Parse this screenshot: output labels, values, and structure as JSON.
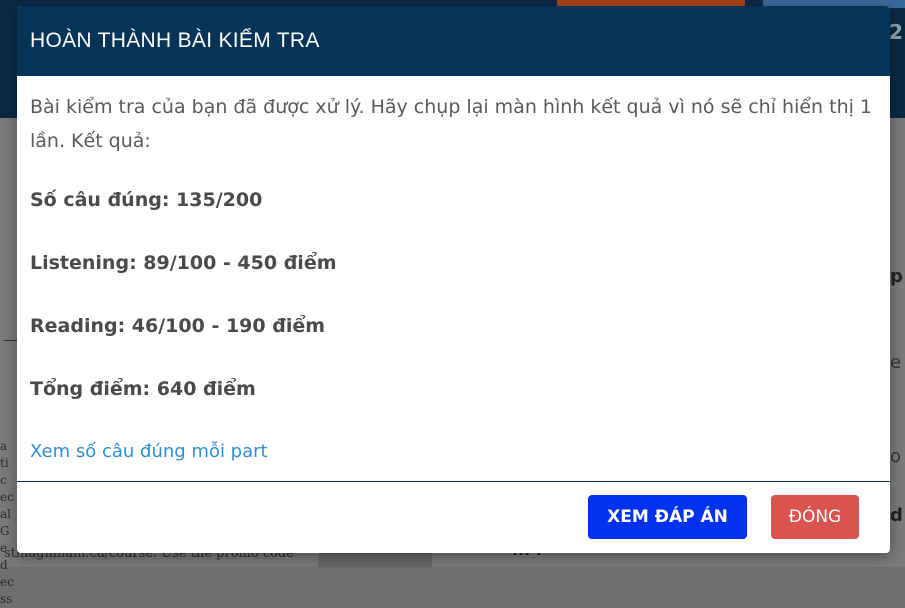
{
  "modal": {
    "title": "HOÀN THÀNH BÀI KIỂM TRA",
    "intro": "Bài kiểm tra của bạn đã được xử lý. Hãy chụp lại màn hình kết quả vì nó sẽ chỉ hiển thị 1 lần. Kết quả:",
    "results": {
      "correct": "Số câu đúng: 135/200",
      "listening": "Listening: 89/100 - 450 điểm",
      "reading": "Reading: 46/100 - 190 điểm",
      "total": "Tổng điểm: 640 điểm"
    },
    "detail_link": "Xem số câu đúng mỗi part",
    "buttons": {
      "view_answers": "XEM ĐÁP ÁN",
      "close": "ĐÓNG"
    },
    "colors": {
      "header": "#063456",
      "primary_button": "#0232ee",
      "close_button": "#d9534f",
      "link": "#2f8fd8"
    }
  },
  "background": {
    "header_digit": "2",
    "left_column_text": "stinagillham.ca/course. Use the promo code",
    "left_edge_text": "a tic ec al G ed ec ss",
    "right_letters": [
      "p",
      "e",
      "o",
      "d"
    ],
    "bottom_fragment": "... ."
  }
}
